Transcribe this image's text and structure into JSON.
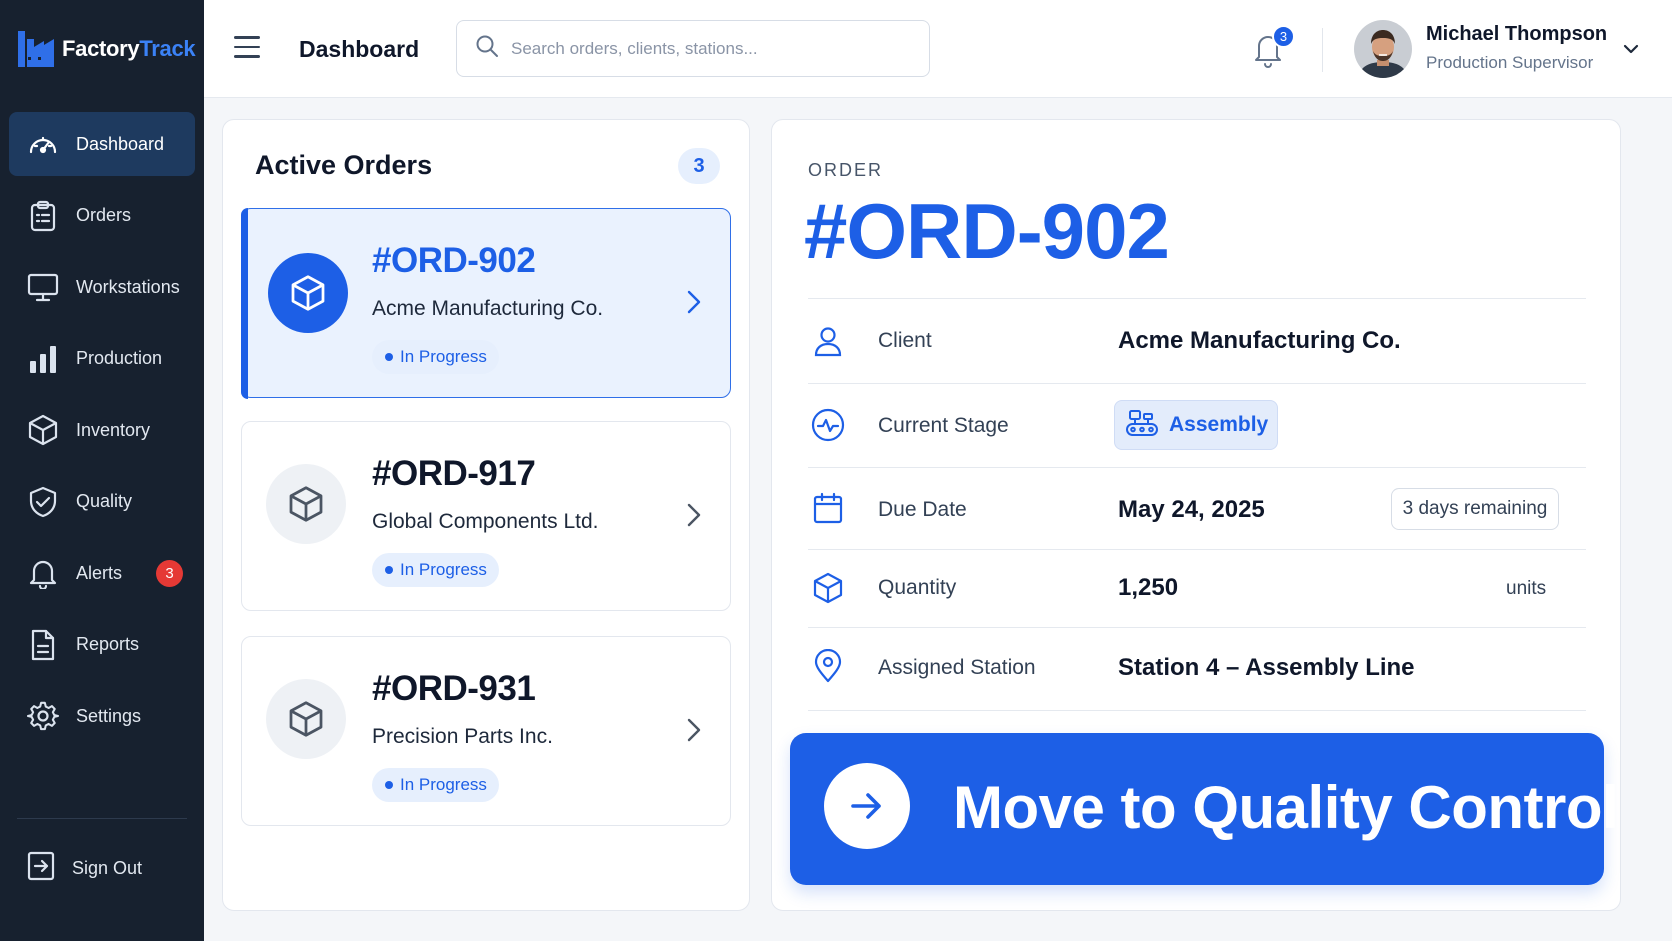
{
  "app": {
    "name_part1": "Factory",
    "name_part2": "Track"
  },
  "sidebar": {
    "items": [
      {
        "label": "Dashboard",
        "icon": "gauge-icon",
        "active": true
      },
      {
        "label": "Orders",
        "icon": "clipboard-icon"
      },
      {
        "label": "Workstations",
        "icon": "monitor-icon"
      },
      {
        "label": "Production",
        "icon": "bar-chart-icon"
      },
      {
        "label": "Inventory",
        "icon": "box-icon"
      },
      {
        "label": "Quality",
        "icon": "shield-check-icon"
      },
      {
        "label": "Alerts",
        "icon": "bell-icon",
        "badge": "3"
      },
      {
        "label": "Reports",
        "icon": "document-icon"
      },
      {
        "label": "Settings",
        "icon": "gear-icon"
      }
    ],
    "signout_label": "Sign Out"
  },
  "header": {
    "title": "Dashboard",
    "search_placeholder": "Search orders, clients, stations...",
    "notifications_count": "3",
    "user": {
      "name": "Michael Thompson",
      "role": "Production Supervisor"
    }
  },
  "orders_panel": {
    "title": "Active Orders",
    "count": "3",
    "orders": [
      {
        "id": "#ORD-902",
        "client": "Acme Manufacturing Co.",
        "status": "In Progress",
        "selected": true
      },
      {
        "id": "#ORD-917",
        "client": "Global Components Ltd.",
        "status": "In Progress"
      },
      {
        "id": "#ORD-931",
        "client": "Precision Parts Inc.",
        "status": "In Progress"
      }
    ]
  },
  "detail": {
    "eyebrow": "ORDER",
    "order_id": "#ORD-902",
    "client_label": "Client",
    "client_value": "Acme Manufacturing Co.",
    "stage_label": "Current Stage",
    "stage_value": "Assembly",
    "due_label": "Due Date",
    "due_value": "May 24, 2025",
    "due_remaining": "3 days remaining",
    "quantity_label": "Quantity",
    "quantity_value": "1,250",
    "quantity_unit": "units",
    "station_label": "Assigned Station",
    "station_value": "Station 4 – Assembly Line",
    "cta_label": "Move to Quality Control"
  },
  "colors": {
    "accent": "#1d5fe6",
    "sidebar_bg": "#17212f",
    "sidebar_active": "#1e3a5f",
    "alert_red": "#e53935"
  }
}
